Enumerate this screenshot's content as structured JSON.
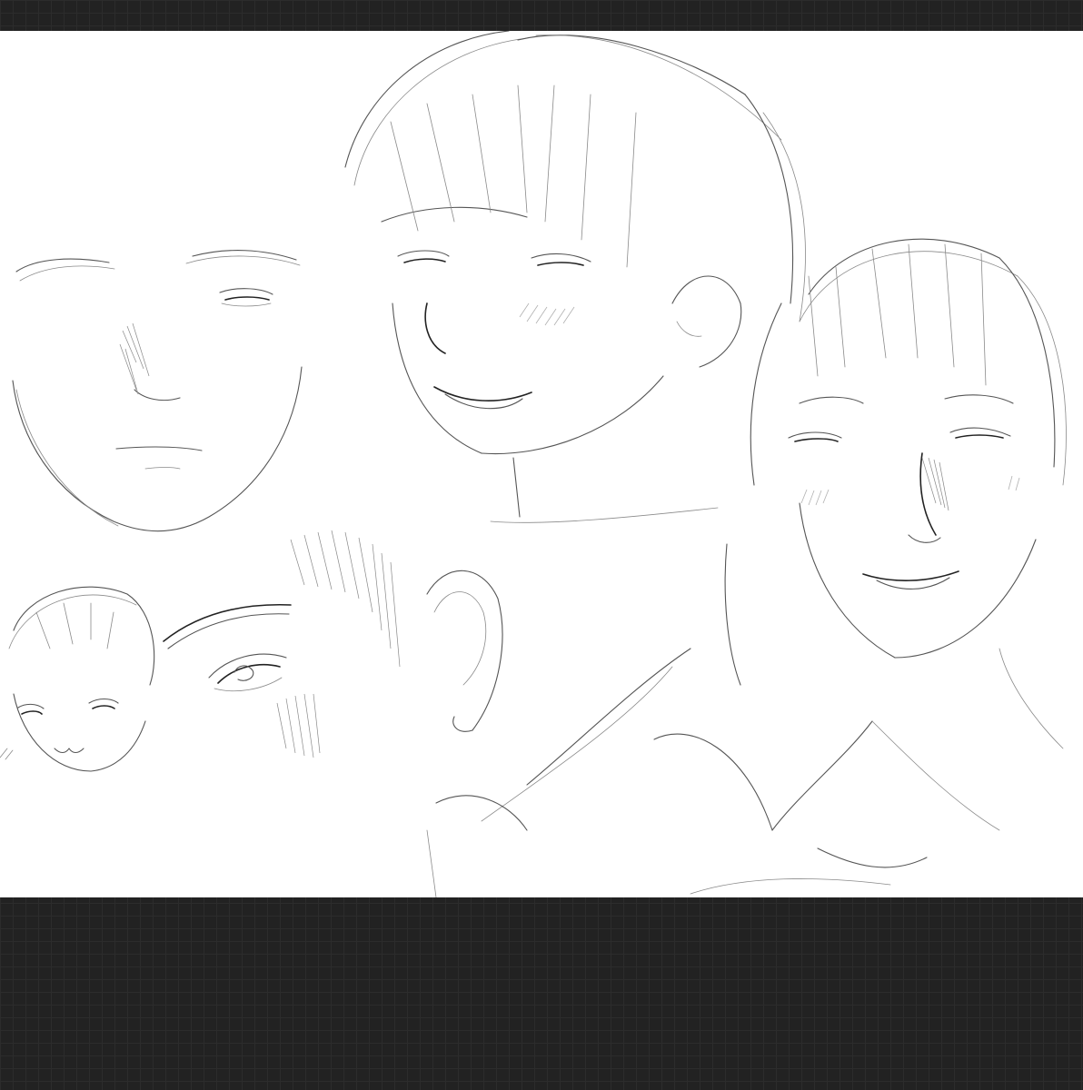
{
  "app": {
    "canvas_background": "#ffffff",
    "workspace_background": "#222222",
    "grid_color": "#2c2c2c",
    "ink_color": "#3a3a3a"
  },
  "sketches": [
    {
      "id": "face-front",
      "label": ""
    },
    {
      "id": "face-smile-bangs",
      "label": ""
    },
    {
      "id": "face-smile-shirt",
      "label": ""
    },
    {
      "id": "face-chibi",
      "label": ""
    },
    {
      "id": "eye-ear-closeup",
      "label": ""
    }
  ]
}
